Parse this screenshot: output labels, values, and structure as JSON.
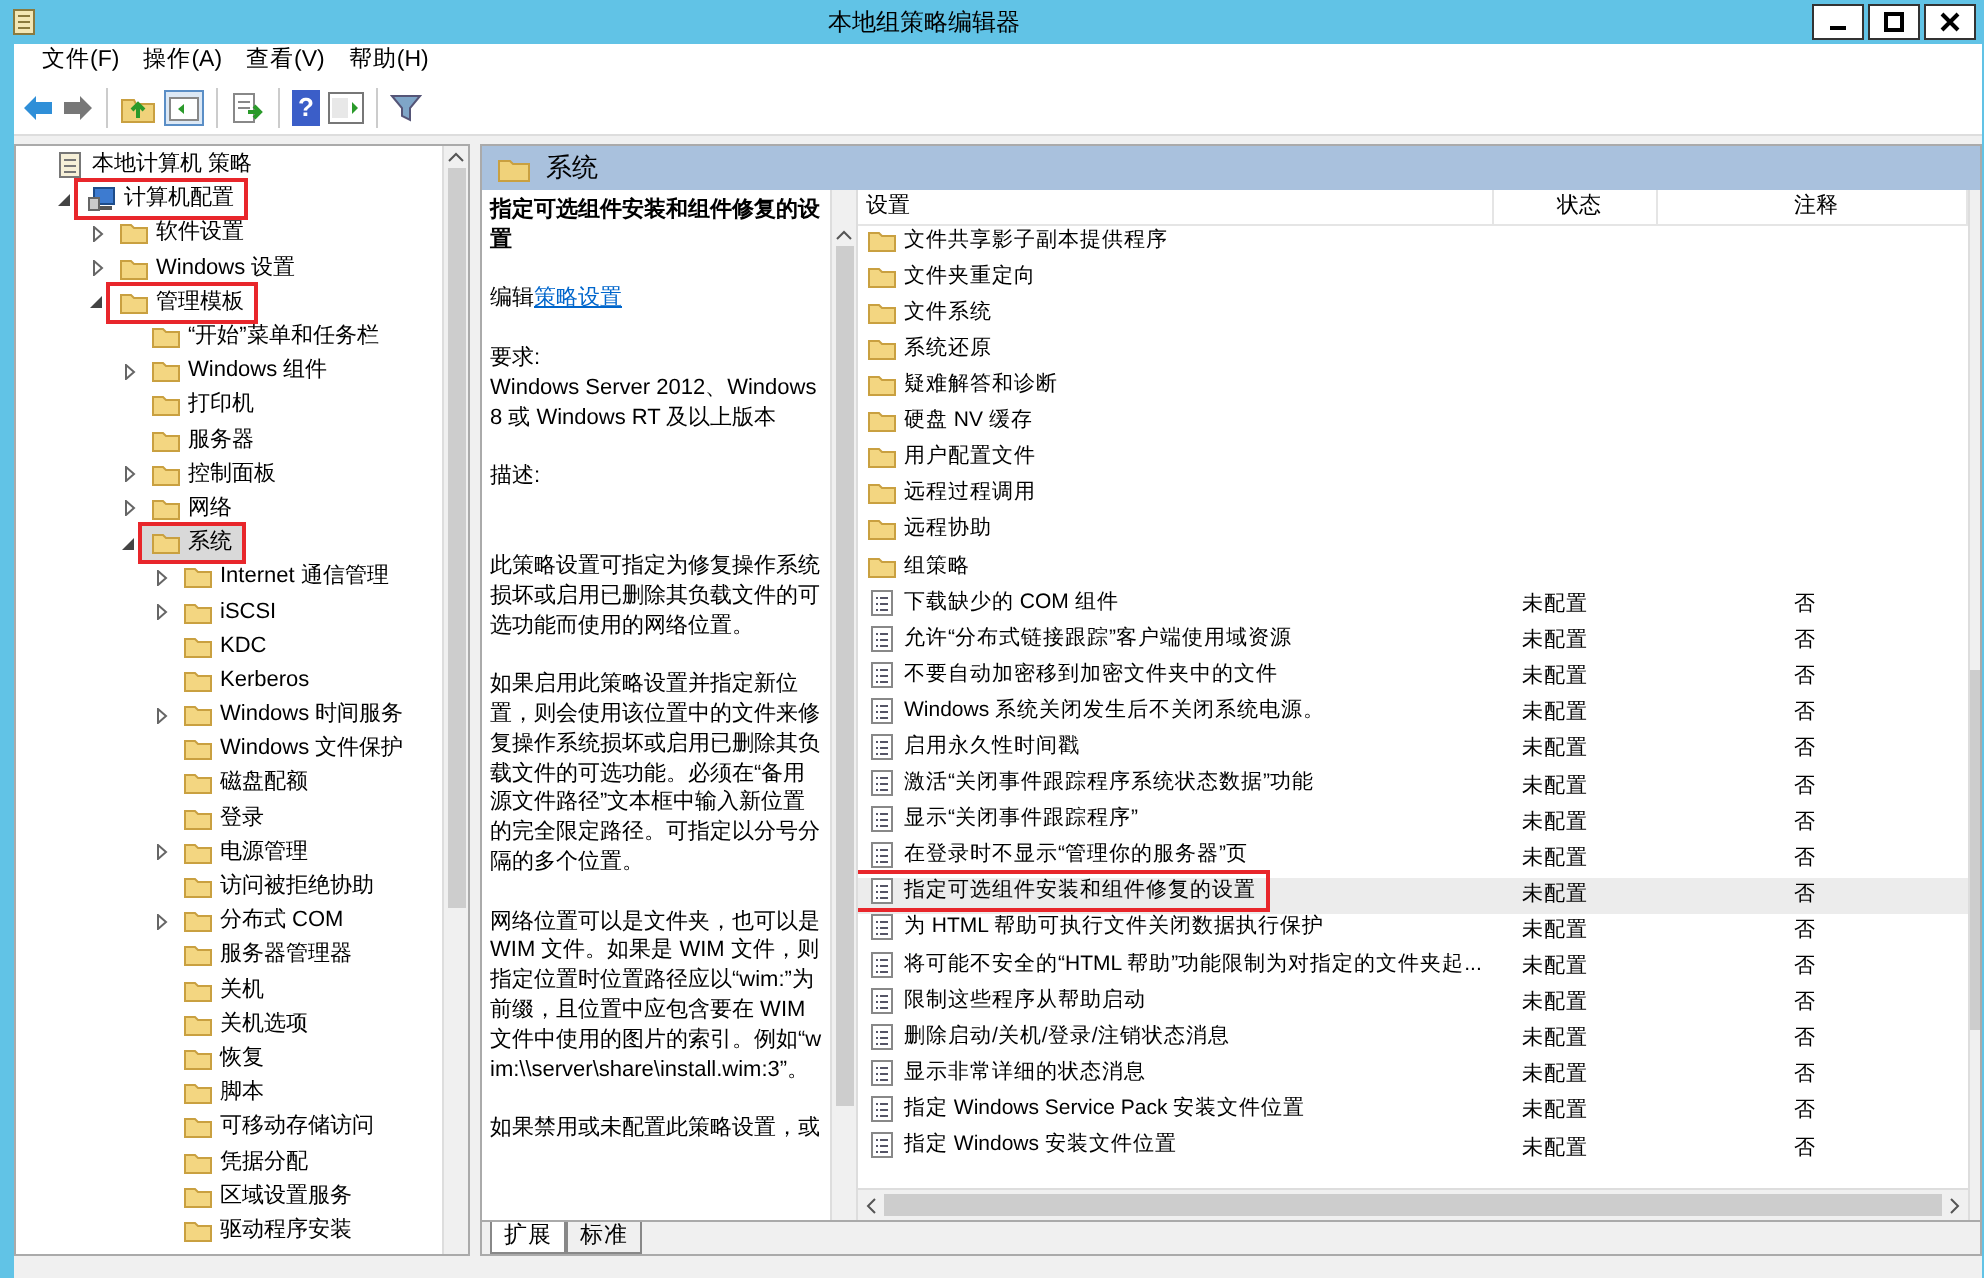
{
  "window": {
    "title": "本地组策略编辑器"
  },
  "menu": [
    "文件(F)",
    "操作(A)",
    "查看(V)",
    "帮助(H)"
  ],
  "toolbar": {
    "help_glyph": "?"
  },
  "tree": [
    {
      "label": "本地计算机 策略",
      "kind": "policy",
      "selected": false,
      "highlighted": false,
      "children": [
        {
          "label": "计算机配置",
          "kind": "computer",
          "expanded": true,
          "selected": false,
          "highlighted": true,
          "children": [
            {
              "label": "软件设置",
              "kind": "folder",
              "expanded": false,
              "selected": false,
              "highlighted": false
            },
            {
              "label": "Windows 设置",
              "kind": "folder",
              "expanded": false,
              "selected": false,
              "highlighted": false
            },
            {
              "label": "管理模板",
              "kind": "folder",
              "expanded": true,
              "selected": false,
              "highlighted": true,
              "children": [
                {
                  "label": "“开始”菜单和任务栏",
                  "kind": "folder",
                  "selected": false,
                  "highlighted": false
                },
                {
                  "label": "Windows 组件",
                  "kind": "folder",
                  "expanded": false,
                  "selected": false,
                  "highlighted": false
                },
                {
                  "label": "打印机",
                  "kind": "folder",
                  "selected": false,
                  "highlighted": false
                },
                {
                  "label": "服务器",
                  "kind": "folder",
                  "selected": false,
                  "highlighted": false
                },
                {
                  "label": "控制面板",
                  "kind": "folder",
                  "expanded": false,
                  "selected": false,
                  "highlighted": false
                },
                {
                  "label": "网络",
                  "kind": "folder",
                  "expanded": false,
                  "selected": false,
                  "highlighted": false
                },
                {
                  "label": "系统",
                  "kind": "folder",
                  "expanded": true,
                  "selected": true,
                  "highlighted": true,
                  "children": [
                    {
                      "label": "Internet 通信管理",
                      "kind": "folder",
                      "expanded": false,
                      "selected": false,
                      "highlighted": false
                    },
                    {
                      "label": "iSCSI",
                      "kind": "folder",
                      "expanded": false,
                      "selected": false,
                      "highlighted": false
                    },
                    {
                      "label": "KDC",
                      "kind": "folder",
                      "selected": false,
                      "highlighted": false
                    },
                    {
                      "label": "Kerberos",
                      "kind": "folder",
                      "selected": false,
                      "highlighted": false
                    },
                    {
                      "label": "Windows 时间服务",
                      "kind": "folder",
                      "expanded": false,
                      "selected": false,
                      "highlighted": false
                    },
                    {
                      "label": "Windows 文件保护",
                      "kind": "folder",
                      "selected": false,
                      "highlighted": false
                    },
                    {
                      "label": "磁盘配额",
                      "kind": "folder",
                      "selected": false,
                      "highlighted": false
                    },
                    {
                      "label": "登录",
                      "kind": "folder",
                      "selected": false,
                      "highlighted": false
                    },
                    {
                      "label": "电源管理",
                      "kind": "folder",
                      "expanded": false,
                      "selected": false,
                      "highlighted": false
                    },
                    {
                      "label": "访问被拒绝协助",
                      "kind": "folder",
                      "selected": false,
                      "highlighted": false
                    },
                    {
                      "label": "分布式 COM",
                      "kind": "folder",
                      "expanded": false,
                      "selected": false,
                      "highlighted": false
                    },
                    {
                      "label": "服务器管理器",
                      "kind": "folder",
                      "selected": false,
                      "highlighted": false
                    },
                    {
                      "label": "关机",
                      "kind": "folder",
                      "selected": false,
                      "highlighted": false
                    },
                    {
                      "label": "关机选项",
                      "kind": "folder",
                      "selected": false,
                      "highlighted": false
                    },
                    {
                      "label": "恢复",
                      "kind": "folder",
                      "selected": false,
                      "highlighted": false
                    },
                    {
                      "label": "脚本",
                      "kind": "folder",
                      "selected": false,
                      "highlighted": false
                    },
                    {
                      "label": "可移动存储访问",
                      "kind": "folder",
                      "selected": false,
                      "highlighted": false
                    },
                    {
                      "label": "凭据分配",
                      "kind": "folder",
                      "selected": false,
                      "highlighted": false
                    },
                    {
                      "label": "区域设置服务",
                      "kind": "folder",
                      "selected": false,
                      "highlighted": false
                    },
                    {
                      "label": "驱动程序安装",
                      "kind": "folder",
                      "selected": false,
                      "highlighted": false
                    }
                  ]
                }
              ]
            }
          ]
        }
      ]
    }
  ],
  "detail": {
    "header": "系统",
    "title": "指定可选组件安装和组件修复的设置",
    "edit_prefix": "编辑",
    "edit_link": "策略设置",
    "requirement_label": "要求:",
    "requirement": "Windows Server 2012、Windows 8 或 Windows RT 及以上版本",
    "description_label": "描述:",
    "paragraphs": [
      "此策略设置可指定为修复操作系统损坏或启用已删除其负载文件的可选功能而使用的网络位置。",
      "如果启用此策略设置并指定新位置，则会使用该位置中的文件来修复操作系统损坏或启用已删除其负载文件的可选功能。必须在“备用源文件路径”文本框中输入新位置的完全限定路径。可指定以分号分隔的多个位置。",
      "网络位置可以是文件夹，也可以是 WIM 文件。如果是 WIM 文件，则指定位置时位置路径应以“wim:”为前缀，且位置中应包含要在 WIM 文件中使用的图片的索引。例如“wim:\\\\server\\share\\install.wim:3”。",
      "如果禁用或未配置此策略设置，或"
    ]
  },
  "table": {
    "columns": [
      "设置",
      "状态",
      "注释"
    ],
    "rows": [
      {
        "kind": "folder",
        "name": "文件共享影子副本提供程序",
        "selected": false,
        "highlighted": false
      },
      {
        "kind": "folder",
        "name": "文件夹重定向",
        "selected": false,
        "highlighted": false
      },
      {
        "kind": "folder",
        "name": "文件系统",
        "selected": false,
        "highlighted": false
      },
      {
        "kind": "folder",
        "name": "系统还原",
        "selected": false,
        "highlighted": false
      },
      {
        "kind": "folder",
        "name": "疑难解答和诊断",
        "selected": false,
        "highlighted": false
      },
      {
        "kind": "folder",
        "name": "硬盘 NV 缓存",
        "selected": false,
        "highlighted": false
      },
      {
        "kind": "folder",
        "name": "用户配置文件",
        "selected": false,
        "highlighted": false
      },
      {
        "kind": "folder",
        "name": "远程过程调用",
        "selected": false,
        "highlighted": false
      },
      {
        "kind": "folder",
        "name": "远程协助",
        "selected": false,
        "highlighted": false
      },
      {
        "kind": "folder",
        "name": "组策略",
        "selected": false,
        "highlighted": false
      },
      {
        "kind": "setting",
        "name": "下载缺少的 COM 组件",
        "state": "未配置",
        "comment": "否",
        "selected": false,
        "highlighted": false
      },
      {
        "kind": "setting",
        "name": "允许“分布式链接跟踪”客户端使用域资源",
        "state": "未配置",
        "comment": "否",
        "selected": false,
        "highlighted": false
      },
      {
        "kind": "setting",
        "name": "不要自动加密移到加密文件夹中的文件",
        "state": "未配置",
        "comment": "否",
        "selected": false,
        "highlighted": false
      },
      {
        "kind": "setting",
        "name": "Windows 系统关闭发生后不关闭系统电源。",
        "state": "未配置",
        "comment": "否",
        "selected": false,
        "highlighted": false
      },
      {
        "kind": "setting",
        "name": "启用永久性时间戳",
        "state": "未配置",
        "comment": "否",
        "selected": false,
        "highlighted": false
      },
      {
        "kind": "setting",
        "name": "激活“关闭事件跟踪程序系统状态数据”功能",
        "state": "未配置",
        "comment": "否",
        "selected": false,
        "highlighted": false
      },
      {
        "kind": "setting",
        "name": "显示“关闭事件跟踪程序”",
        "state": "未配置",
        "comment": "否",
        "selected": false,
        "highlighted": false
      },
      {
        "kind": "setting",
        "name": "在登录时不显示“管理你的服务器”页",
        "state": "未配置",
        "comment": "否",
        "selected": false,
        "highlighted": false
      },
      {
        "kind": "setting",
        "name": "指定可选组件安装和组件修复的设置",
        "state": "未配置",
        "comment": "否",
        "selected": true,
        "highlighted": true
      },
      {
        "kind": "setting",
        "name": "为 HTML 帮助可执行文件关闭数据执行保护",
        "state": "未配置",
        "comment": "否",
        "selected": false,
        "highlighted": false
      },
      {
        "kind": "setting",
        "name": "将可能不安全的“HTML 帮助”功能限制为对指定的文件夹起...",
        "state": "未配置",
        "comment": "否",
        "selected": false,
        "highlighted": false
      },
      {
        "kind": "setting",
        "name": "限制这些程序从帮助启动",
        "state": "未配置",
        "comment": "否",
        "selected": false,
        "highlighted": false
      },
      {
        "kind": "setting",
        "name": "删除启动/关机/登录/注销状态消息",
        "state": "未配置",
        "comment": "否",
        "selected": false,
        "highlighted": false
      },
      {
        "kind": "setting",
        "name": "显示非常详细的状态消息",
        "state": "未配置",
        "comment": "否",
        "selected": false,
        "highlighted": false
      },
      {
        "kind": "setting",
        "name": "指定 Windows Service Pack 安装文件位置",
        "state": "未配置",
        "comment": "否",
        "selected": false,
        "highlighted": false
      },
      {
        "kind": "setting",
        "name": "指定 Windows 安装文件位置",
        "state": "未配置",
        "comment": "否",
        "selected": false,
        "highlighted": false
      }
    ]
  },
  "bottom_tabs": [
    {
      "label": "扩展",
      "selected": true
    },
    {
      "label": "标准",
      "selected": false
    }
  ]
}
